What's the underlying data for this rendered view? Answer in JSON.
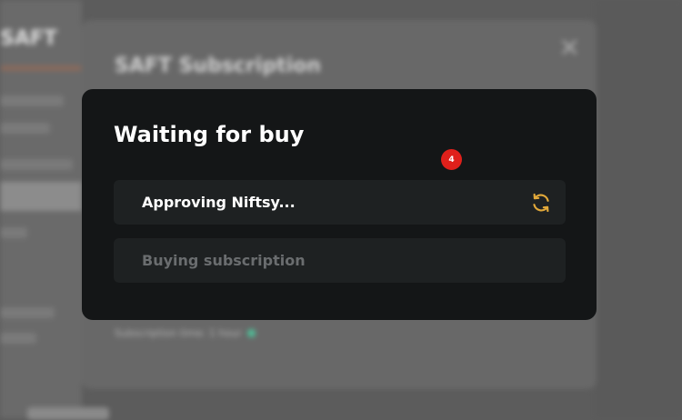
{
  "background": {
    "page_title": "SAFT",
    "modal_title": "SAFT Subscription",
    "status_text": "Subscription time: 1 hour",
    "status_color": "#4ec29a"
  },
  "dialog": {
    "title": "Waiting for buy",
    "steps": [
      {
        "label": "Approving Niftsy...",
        "state": "in-progress",
        "icon": "refresh-icon"
      },
      {
        "label": "Buying subscription",
        "state": "pending"
      }
    ],
    "spinner_color": "#e2a93a"
  },
  "badge": {
    "count": "4",
    "color": "#e0201b"
  }
}
